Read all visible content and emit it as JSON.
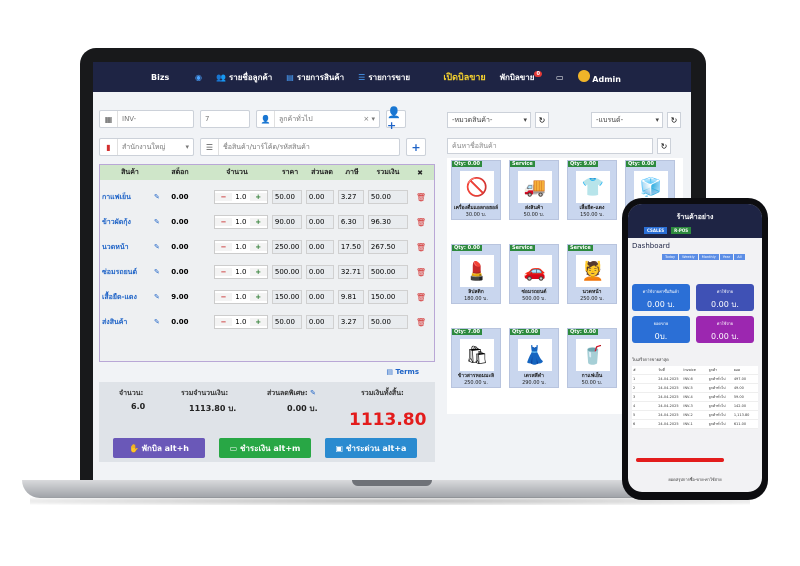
{
  "nav": {
    "brand": "Bizs",
    "customers": "รายชื่อลูกค้า",
    "products": "รายการสินค้า",
    "sales": "รายการขาย",
    "open_sale": "เปิดบิลขาย",
    "hold_bill": "พักบิลขาย",
    "hold_count": "0",
    "user": "Admin"
  },
  "form": {
    "invoice_placeholder": "INV-",
    "doc_no": "7",
    "customer": "ลูกค้าทั่วไป",
    "branch": "สำนักงานใหญ่",
    "search_placeholder": "ชื่อสินค้า/บาร์โค้ด/รหัสสินค้า"
  },
  "cart": {
    "headers": [
      "สินค้า",
      "สต็อก",
      "จำนวน",
      "ราคา",
      "ส่วนลด",
      "ภาษี",
      "รวมเงิน",
      "✖"
    ],
    "rows": [
      {
        "name": "กาแฟเย็น",
        "stock": "0.00",
        "qty": "1.0",
        "price": "50.00",
        "discount": "0.00",
        "tax": "3.27",
        "total": "50.00"
      },
      {
        "name": "ข้าวผัดกุ้ง",
        "stock": "0.00",
        "qty": "1.0",
        "price": "90.00",
        "discount": "0.00",
        "tax": "6.30",
        "total": "96.30"
      },
      {
        "name": "นวดหน้า",
        "stock": "0.00",
        "qty": "1.0",
        "price": "250.00",
        "discount": "0.00",
        "tax": "17.50",
        "total": "267.50"
      },
      {
        "name": "ซ่อมรถยนต์",
        "stock": "0.00",
        "qty": "1.0",
        "price": "500.00",
        "discount": "0.00",
        "tax": "32.71",
        "total": "500.00"
      },
      {
        "name": "เสื้อยืด-แดง",
        "stock": "9.00",
        "qty": "1.0",
        "price": "150.00",
        "discount": "0.00",
        "tax": "9.81",
        "total": "150.00"
      },
      {
        "name": "ส่งสินค้า",
        "stock": "0.00",
        "qty": "1.0",
        "price": "50.00",
        "discount": "0.00",
        "tax": "3.27",
        "total": "50.00"
      }
    ],
    "terms": "Terms"
  },
  "summary": {
    "qty_label": "จำนวน:",
    "qty": "6.0",
    "subtotal_label": "รวมจำนวนเงิน:",
    "subtotal": "1113.80 บ.",
    "discount_label": "ส่วนลดพิเศษ:",
    "discount": "0.00 บ.",
    "grand_label": "รวมเงินทั้งสิ้น:",
    "grand": "1113.80",
    "hold_btn": "พักบิล alt+h",
    "pay_btn": "ชำระเงิน alt+m",
    "quick_btn": "ชำระด่วน alt+a"
  },
  "catalog": {
    "category": "-หมวดสินค้า-",
    "brand": "-แบรนด์-",
    "search_placeholder": "ค้นหาชื่อสินค้า",
    "items": [
      {
        "tag": "Qty: 0.00",
        "name": "เครื่องดื่มแอลกอฮอล์",
        "price": "30.00 บ.",
        "icon": "no-alcohol-icon"
      },
      {
        "tag": "Service",
        "name": "ส่งสินค้า",
        "price": "50.00 บ.",
        "icon": "truck-icon"
      },
      {
        "tag": "Qty: 9.00",
        "name": "เสื้อยืด-แดง",
        "price": "150.00 บ.",
        "icon": "tshirt-icon"
      },
      {
        "tag": "Qty: 0.00",
        "name": "รูบิค",
        "price": "150.00 บ.",
        "icon": "cube-icon"
      },
      {
        "tag": "Qty: 0.00",
        "name": "ลิปสติก",
        "price": "180.00 บ.",
        "icon": "lipstick-icon"
      },
      {
        "tag": "Service",
        "name": "ซ่อมรถยนต์",
        "price": "500.00 บ.",
        "icon": "car-icon"
      },
      {
        "tag": "Service",
        "name": "นวดหน้า",
        "price": "250.00 บ.",
        "icon": "spa-icon"
      },
      {
        "tag": "Qty: 7.00",
        "name": "ข้าวสารหอมมะลิ",
        "price": "250.00 บ.",
        "icon": "rice-bag-icon"
      },
      {
        "tag": "Qty: 0.00",
        "name": "เดรสสีดำ",
        "price": "290.00 บ.",
        "icon": "dress-icon"
      },
      {
        "tag": "Qty: 0.00",
        "name": "กาแฟเย็น",
        "price": "50.00 บ.",
        "icon": "coffee-icon"
      }
    ]
  },
  "phone": {
    "title": "ร้านค้าอย่าง",
    "tab1": "CSALES",
    "tab2": "R-POS",
    "dashboard": "Dashboard",
    "filters": [
      "Today",
      "Weekly",
      "Monthly",
      "Year",
      "All"
    ],
    "cards": [
      {
        "label": "ค่าใช้จ่ายค่าซื้อสินค้า",
        "value": "0.00 บ.",
        "color": "#2b6fd6"
      },
      {
        "label": "ค่าใช้จ่าย",
        "value": "0.00 บ.",
        "color": "#3f51b5"
      },
      {
        "label": "ยอดขาย",
        "value": "0บ.",
        "color": "#2b6fd6"
      },
      {
        "label": "ค่าใช้จ่าย",
        "value": "0.00 บ.",
        "color": "#9c27b0"
      }
    ],
    "recent_title": "ใบเสร็จการขายล่าสุด",
    "table_headers": [
      "#",
      "วันที่",
      "Invoice",
      "ลูกค้า",
      "ยอด"
    ],
    "rows": [
      [
        "1",
        "24-04-2025",
        "INV-6",
        "ลูกค้าทั่วไป",
        "497.00"
      ],
      [
        "2",
        "24-04-2025",
        "INV-5",
        "ลูกค้าทั่วไป",
        "49.00"
      ],
      [
        "3",
        "24-04-2025",
        "INV-4",
        "ลูกค้าทั่วไป",
        "59.00"
      ],
      [
        "4",
        "24-04-2025",
        "INV-3",
        "ลูกค้าทั่วไป",
        "142.00"
      ],
      [
        "5",
        "24-04-2025",
        "INV-2",
        "ลูกค้าทั่วไป",
        "1,113.80"
      ],
      [
        "6",
        "24-04-2025",
        "INV-1",
        "ลูกค้าทั่วไป",
        "611.00"
      ]
    ],
    "footer": "ยอดสรุปการซื้อ-ขาย-ค่าใช้จ่าย"
  }
}
